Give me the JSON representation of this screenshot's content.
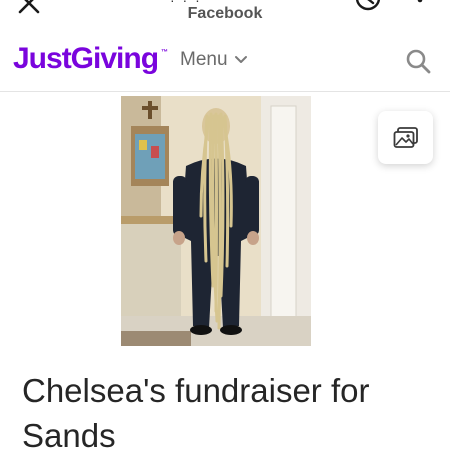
{
  "browser": {
    "title": "Facebook",
    "url_fragment": "·  ·  ·",
    "close_icon": "close-icon",
    "history_icon": "history-icon",
    "more_icon": "more-vertical-icon"
  },
  "nav": {
    "logo_text": "JustGiving",
    "logo_tm": "™",
    "menu_label": "Menu",
    "menu_icon": "chevron-down-icon",
    "search_icon": "search-icon"
  },
  "hero": {
    "image_description_icon": "photo",
    "gallery_icon": "gallery-icon"
  },
  "page": {
    "title": "Chelsea's fundraiser for Sands"
  },
  "colors": {
    "brand": "#7a04dd",
    "text": "#262626",
    "muted": "#6a6a6a"
  }
}
